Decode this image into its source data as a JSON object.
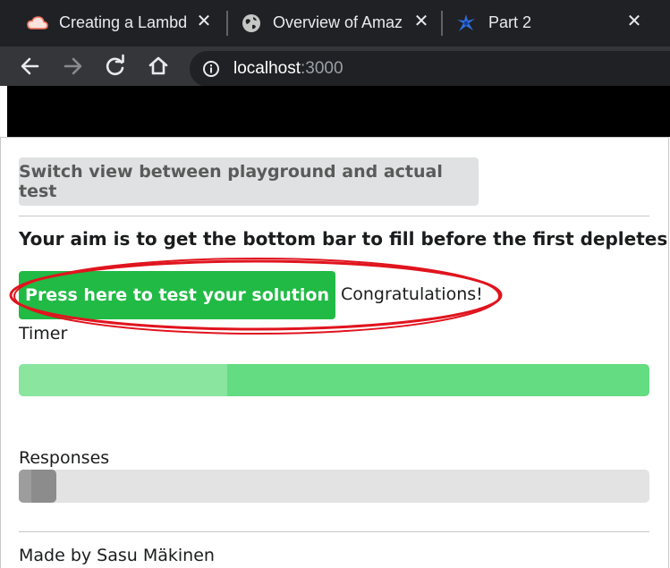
{
  "browser": {
    "tabs": [
      {
        "title": "Creating a Lambda",
        "icon": "cloud-icon"
      },
      {
        "title": "Overview of Amaz",
        "icon": "globe-icon"
      },
      {
        "title": "Part 2",
        "icon": "app-logo-icon"
      }
    ],
    "close_glyph": "✕",
    "url_host": "localhost",
    "url_port": ":3000"
  },
  "page": {
    "switch_button_label": "Switch view between playground and actual test",
    "aim_text": "Your aim is to get the bottom bar to fill before the first depletes!",
    "test_button_label": "Press here to test your solution",
    "result_text": "Congratulations!",
    "timer_label": "Timer",
    "timer_level": 0.33,
    "responses_label": "Responses",
    "responses_level": 0.06,
    "footer_text": "Made by Sasu Mäkinen"
  },
  "colors": {
    "primary_button": "#21ba45",
    "timer_bar": "#64dc81",
    "annotation": "#e0141e"
  }
}
